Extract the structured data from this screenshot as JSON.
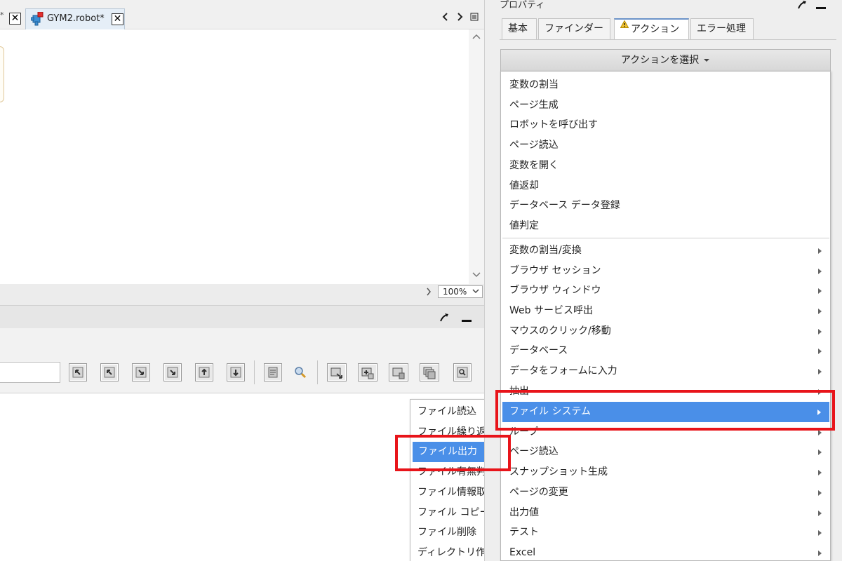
{
  "editor": {
    "active_tab_title": "GYM2.robot*",
    "zoom_level": "100%"
  },
  "properties": {
    "title": "プロパティ",
    "tabs": [
      {
        "label": "基本"
      },
      {
        "label": "ファインダー"
      },
      {
        "label": "アクション",
        "warning": true
      },
      {
        "label": "エラー処理"
      }
    ],
    "action_select_label": "アクションを選択"
  },
  "action_menu": {
    "simple_items": [
      "変数の割当",
      "ページ生成",
      "ロボットを呼び出す",
      "ページ読込",
      "変数を開く",
      "値返却",
      "データベース データ登録",
      "値判定"
    ],
    "submenu_items": [
      "変数の割当/変換",
      "ブラウザ セッション",
      "ブラウザ ウィンドウ",
      "Web サービス呼出",
      "マウスのクリック/移動",
      "データベース",
      "データをフォームに入力",
      "抽出",
      "ファイル システム",
      "ループ",
      "ページ読込",
      "スナップショット生成",
      "ページの変更",
      "出力値",
      "テスト",
      "Excel"
    ],
    "highlighted": "ファイル システム"
  },
  "file_system_submenu": {
    "items": [
      "ファイル読込",
      "ファイル繰り返し",
      "ファイル出力",
      "ファイル有無判定",
      "ファイル情報取得",
      "ファイル コピー",
      "ファイル削除",
      "ディレクトリ作成"
    ],
    "highlighted": "ファイル出力"
  },
  "colors": {
    "highlight": "#4a8fe8",
    "annotation": "#e8141a"
  }
}
